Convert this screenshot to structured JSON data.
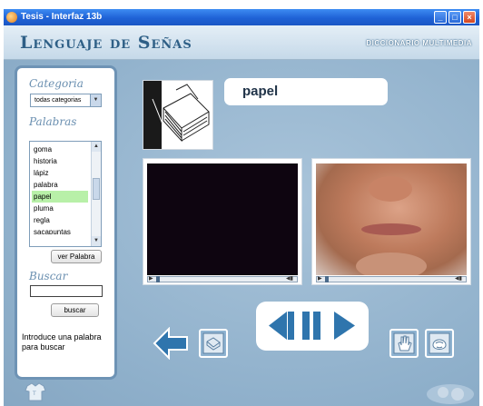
{
  "window": {
    "title": "Tesis - Interfaz 13b"
  },
  "header": {
    "app_title": "Lenguaje de Señas",
    "subtitle": "DICCIONARIO MULTIMEDIA"
  },
  "sidebar": {
    "categoria_label": "Categoria",
    "category_select": {
      "value": "todas categorias"
    },
    "palabras_label": "Palabras",
    "words": [
      "goma",
      "historia",
      "lápiz",
      "palabra",
      "papel",
      "pluma",
      "regla",
      "sacapuntas"
    ],
    "selected_word": "papel",
    "ver_palabra_button": "ver Palabra",
    "buscar_label": "Buscar",
    "search": {
      "value": ""
    },
    "buscar_button": "buscar",
    "hint": "Introduce una palabra para buscar"
  },
  "main": {
    "current_word": "papel",
    "thumbnail_icon": "paper-stack-icon"
  },
  "colors": {
    "background": "#9cb9d2",
    "panel_border": "#6e93b5",
    "accent": "#2f75ad",
    "selected_row": "#b8f0a8"
  }
}
